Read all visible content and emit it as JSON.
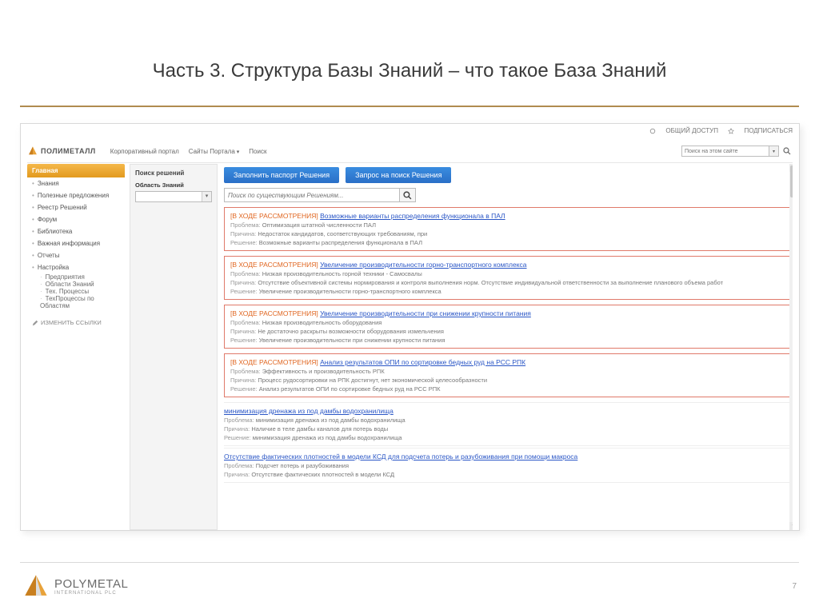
{
  "slide": {
    "title": "Часть 3. Структура Базы Знаний – что такое База Знаний",
    "page_number": "7"
  },
  "footer_logo": {
    "name": "POLYMETAL",
    "sub": "INTERNATIONAL PLC"
  },
  "portal": {
    "top_links": {
      "share": "ОБЩИЙ ДОСТУП",
      "subscribe": "ПОДПИСАТЬСЯ"
    },
    "logo_text": "ПОЛИМЕТАЛЛ",
    "nav": {
      "item1": "Корпоративный портал",
      "item2": "Сайты Портала",
      "item3": "Поиск"
    },
    "site_search_placeholder": "Поиск на этом сайте"
  },
  "sidebar": {
    "active": "Главная",
    "items": [
      "Знания",
      "Полезные предложения",
      "Реестр Решений",
      "Форум",
      "Библиотека",
      "Важная информация",
      "Отчеты",
      "Настройка"
    ],
    "subitems": [
      "Предприятия",
      "Области Знаний",
      "Тех. Процессы",
      "ТехПроцессы по Областям"
    ],
    "edit": "ИЗМЕНИТЬ ССЫЛКИ"
  },
  "filter": {
    "title": "Поиск решений",
    "field_label": "Область Знаний"
  },
  "actions": {
    "fill": "Заполнить паспорт Решения",
    "request": "Запрос на поиск Решения"
  },
  "search": {
    "placeholder": "Поиск по существующим Решениям..."
  },
  "status_text": "[В ХОДЕ РАССМОТРЕНИЯ]",
  "labels": {
    "problem": "Проблема:",
    "reason": "Причина:",
    "solution": "Решение:"
  },
  "items": [
    {
      "highlighted": true,
      "title": "Возможные варианты распределения функционала в ПАЛ",
      "problem": "Оптимизация штатной численности ПАЛ",
      "reason": "Недостаток кандидатов, соответствующих требованиям, при",
      "solution": "Возможные варианты распределения функционала в ПАЛ"
    },
    {
      "highlighted": true,
      "title": "Увеличение производительности горно-транспортного комплекса",
      "problem": "Низкая производительность горной техники - Самосвалы",
      "reason": "Отсутствие объективной системы нормирования и контроля выполнения норм. Отсутствие индивидуальной ответственности за выполнение планового объема работ",
      "solution": "Увеличение производительности горно-транспортного комплекса"
    },
    {
      "highlighted": true,
      "title": "Увеличение производительности при снижении крупности питания",
      "problem": "Низкая производительность оборудования",
      "reason": "Не достаточно раскрыты возможности оборудования измельчения",
      "solution": "Увеличение производительности при снижении крупности питания"
    },
    {
      "highlighted": true,
      "title": "Анализ результатов ОПИ по сортировке бедных руд на РСС РПК",
      "problem": "Эффективность и производительность РПК",
      "reason": "Процесс рудосортировки на РПК достигнут, нет экономической целесообразности",
      "solution": "Анализ результатов ОПИ по сортировке бедных руд на РСС РПК"
    },
    {
      "highlighted": false,
      "title": "минимизация дренажа из под дамбы водохранилища",
      "problem": "минимизация дренажа из под дамбы водохранилища",
      "reason": "Наличие в теле дамбы каналов для потерь воды",
      "solution": "минимизация дренажа из под дамбы водохранилища"
    },
    {
      "highlighted": false,
      "title": "Отсутствие фактических плотностей в модели КСД для подсчета потерь и разубоживания при помощи макроса",
      "problem": "Подсчет потерь и разубоживания",
      "reason": "Отсутствие фактических плотностей в модели КСД",
      "solution": ""
    }
  ]
}
